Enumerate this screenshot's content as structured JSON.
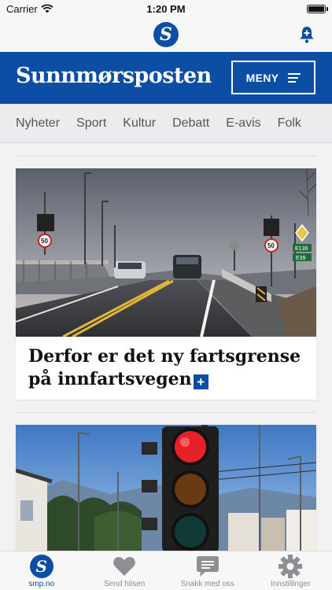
{
  "status_bar": {
    "carrier": "Carrier",
    "time": "1:20 PM",
    "battery_level": 1.0
  },
  "app_bar": {
    "logo_letter": "S",
    "bell_icon": "bell-plus-icon"
  },
  "brand": {
    "wordmark": "Sunnmørsposten",
    "menu_label": "MENY",
    "menu_icon": "menu-lines-icon"
  },
  "nav": {
    "tabs": [
      "Nyheter",
      "Sport",
      "Kultur",
      "Debatt",
      "E-avis",
      "Folk"
    ]
  },
  "feed": {
    "articles": [
      {
        "headline": "Derfor er det ny fartsgrense på innfartsvegen",
        "premium_badge": "+",
        "image": "road-bridge-photo"
      },
      {
        "headline": "",
        "image": "traffic-light-photo"
      }
    ]
  },
  "bottom_tabs": [
    {
      "label": "smp.no",
      "icon": "smp-logo-icon",
      "active": true
    },
    {
      "label": "Send hilsen",
      "icon": "heart-icon",
      "active": false
    },
    {
      "label": "Snakk med oss",
      "icon": "chat-bubble-icon",
      "active": false
    },
    {
      "label": "Innstillinger",
      "icon": "gear-icon",
      "active": false
    }
  ],
  "colors": {
    "brand_blue": "#0c4ea3",
    "inactive_gray": "#8e8e93"
  }
}
